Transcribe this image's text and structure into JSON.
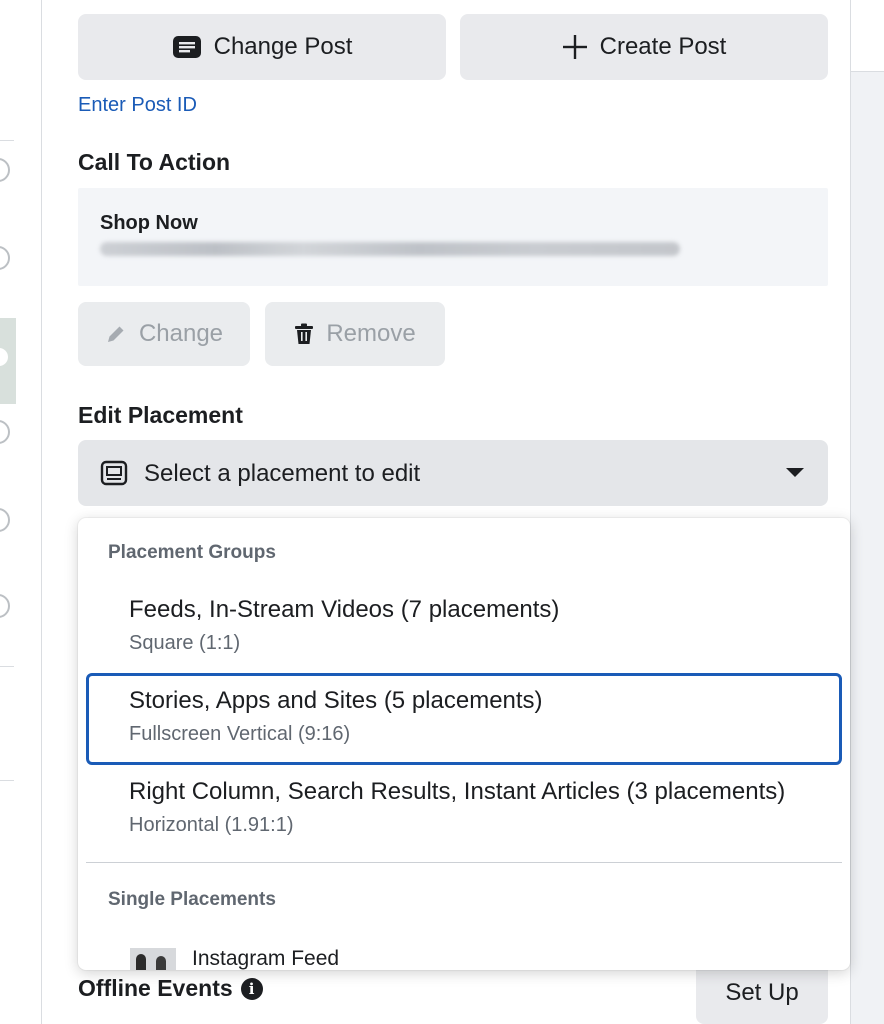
{
  "post_actions": {
    "change_post_label": "Change Post",
    "create_post_label": "Create Post",
    "enter_post_id_link": "Enter Post ID"
  },
  "call_to_action": {
    "heading": "Call To Action",
    "card_title": "Shop Now",
    "change_label": "Change",
    "remove_label": "Remove"
  },
  "edit_placement": {
    "heading": "Edit Placement",
    "select_placeholder": "Select a placement to edit"
  },
  "dropdown": {
    "group_heading": "Placement Groups",
    "groups": [
      {
        "title": "Feeds, In-Stream Videos (7 placements)",
        "subtitle": "Square (1:1)",
        "selected": false
      },
      {
        "title": "Stories, Apps and Sites (5 placements)",
        "subtitle": "Fullscreen Vertical (9:16)",
        "selected": true
      },
      {
        "title": "Right Column, Search Results, Instant Articles (3 placements)",
        "subtitle": "Horizontal (1.91:1)",
        "selected": false
      }
    ],
    "single_heading": "Single Placements",
    "single_items": [
      {
        "title": "Instagram Feed"
      }
    ]
  },
  "offline_events": {
    "heading": "Offline Events",
    "setup_label": "Set Up"
  },
  "colors": {
    "link": "#1a5bb7",
    "selected_border": "#1a5bb7",
    "button_bg": "#e9eaed"
  }
}
